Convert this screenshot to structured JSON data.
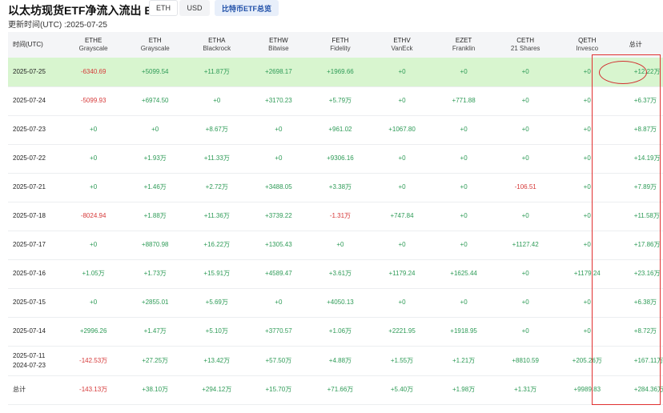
{
  "header": {
    "title": "以太坊现货ETF净流入流出 ETH",
    "updated": "更新时间(UTC) :2025-07-25",
    "toggles": {
      "eth": "ETH",
      "usd": "USD",
      "btc_link": "比特币ETF总览"
    }
  },
  "table": {
    "date_header": "时间(UTC)",
    "total_header": "总计",
    "funds": [
      {
        "ticker": "ETHE",
        "issuer": "Grayscale"
      },
      {
        "ticker": "ETH",
        "issuer": "Grayscale"
      },
      {
        "ticker": "ETHA",
        "issuer": "Blackrock"
      },
      {
        "ticker": "ETHW",
        "issuer": "Bitwise"
      },
      {
        "ticker": "FETH",
        "issuer": "Fidelity"
      },
      {
        "ticker": "ETHV",
        "issuer": "VanEck"
      },
      {
        "ticker": "EZET",
        "issuer": "Franklin"
      },
      {
        "ticker": "CETH",
        "issuer": "21 Shares"
      },
      {
        "ticker": "QETH",
        "issuer": "Invesco"
      }
    ],
    "rows": [
      {
        "date": "2025-07-25",
        "cells": [
          "-6340.69",
          "+5099.54",
          "+11.87万",
          "+2698.17",
          "+1969.66",
          "+0",
          "+0",
          "+0",
          "+0"
        ],
        "total": "+12.22万"
      },
      {
        "date": "2025-07-24",
        "cells": [
          "-5099.93",
          "+6974.50",
          "+0",
          "+3170.23",
          "+5.79万",
          "+0",
          "+771.88",
          "+0",
          "+0"
        ],
        "total": "+6.37万"
      },
      {
        "date": "2025-07-23",
        "cells": [
          "+0",
          "+0",
          "+8.67万",
          "+0",
          "+961.02",
          "+1067.80",
          "+0",
          "+0",
          "+0"
        ],
        "total": "+8.87万"
      },
      {
        "date": "2025-07-22",
        "cells": [
          "+0",
          "+1.93万",
          "+11.33万",
          "+0",
          "+9306.16",
          "+0",
          "+0",
          "+0",
          "+0"
        ],
        "total": "+14.19万"
      },
      {
        "date": "2025-07-21",
        "cells": [
          "+0",
          "+1.46万",
          "+2.72万",
          "+3488.05",
          "+3.38万",
          "+0",
          "+0",
          "-106.51",
          "+0"
        ],
        "total": "+7.89万"
      },
      {
        "date": "2025-07-18",
        "cells": [
          "-8024.94",
          "+1.88万",
          "+11.36万",
          "+3739.22",
          "-1.31万",
          "+747.84",
          "+0",
          "+0",
          "+0"
        ],
        "total": "+11.58万"
      },
      {
        "date": "2025-07-17",
        "cells": [
          "+0",
          "+8870.98",
          "+16.22万",
          "+1305.43",
          "+0",
          "+0",
          "+0",
          "+1127.42",
          "+0"
        ],
        "total": "+17.86万"
      },
      {
        "date": "2025-07-16",
        "cells": [
          "+1.05万",
          "+1.73万",
          "+15.91万",
          "+4589.47",
          "+3.61万",
          "+1179.24",
          "+1625.44",
          "+0",
          "+1179.24"
        ],
        "total": "+23.16万"
      },
      {
        "date": "2025-07-15",
        "cells": [
          "+0",
          "+2855.01",
          "+5.69万",
          "+0",
          "+4050.13",
          "+0",
          "+0",
          "+0",
          "+0"
        ],
        "total": "+6.38万"
      },
      {
        "date": "2025-07-14",
        "cells": [
          "+2996.26",
          "+1.47万",
          "+5.10万",
          "+3770.57",
          "+1.06万",
          "+2221.95",
          "+1918.95",
          "+0",
          "+0"
        ],
        "total": "+8.72万"
      },
      {
        "date": "2025-07-11\n2024-07-23",
        "cells": [
          "-142.53万",
          "+27.25万",
          "+13.42万",
          "+57.50万",
          "+4.88万",
          "+1.55万",
          "+1.21万",
          "+8810.59",
          "+205.26万"
        ],
        "total": "+167.11万"
      },
      {
        "date": "总计",
        "cells": [
          "-143.13万",
          "+38.10万",
          "+294.12万",
          "+15.70万",
          "+71.66万",
          "+5.40万",
          "+1.98万",
          "+1.31万",
          "+9989.83"
        ],
        "total": "+284.36万"
      }
    ]
  },
  "colors": {
    "positive": "#2e9b57",
    "negative": "#d63a3a",
    "highlight_row": "#d8f5cf",
    "annotation": "#e03030"
  }
}
